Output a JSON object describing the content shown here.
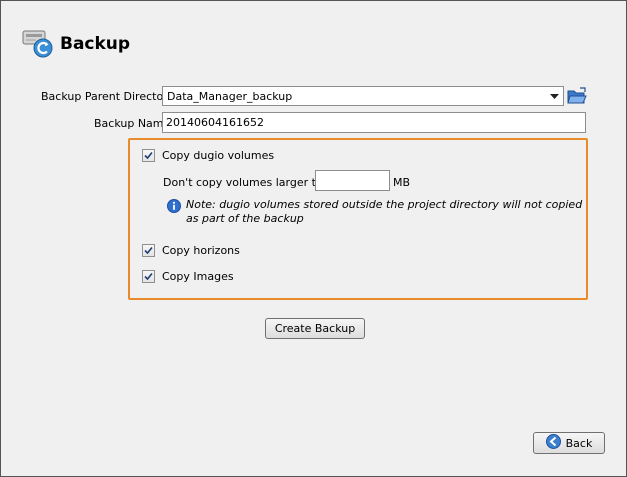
{
  "header": {
    "title": "Backup",
    "icon": "backup-drive-icon"
  },
  "form": {
    "parent_dir_label": "Backup Parent Directory",
    "parent_dir_value": "Data_Manager_backup",
    "backup_name_label": "Backup Name",
    "backup_name_value": "20140604161652"
  },
  "options": {
    "copy_dugio": {
      "label": "Copy dugio volumes",
      "checked": true
    },
    "size_limit_label": "Don't copy volumes larger than",
    "size_limit_value": "",
    "size_limit_unit": "MB",
    "note": "Note: dugio volumes stored outside the project directory will not copied as part of the backup",
    "copy_horizons": {
      "label": "Copy horizons",
      "checked": true
    },
    "copy_images": {
      "label": "Copy Images",
      "checked": true
    }
  },
  "actions": {
    "create_label": "Create Backup",
    "back_label": "Back"
  },
  "colors": {
    "highlight_border": "#e98a2b",
    "info_icon": "#2f6fd0"
  }
}
